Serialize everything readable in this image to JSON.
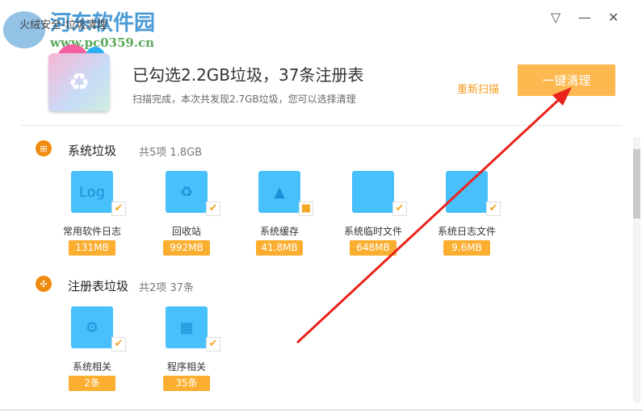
{
  "window": {
    "title": "火绒安全-垃圾清理",
    "watermark": "河东软件园",
    "watermark_url": "www.pc0359.cn"
  },
  "controls": {
    "menu": "▽",
    "minimize": "—",
    "close": "✕"
  },
  "header": {
    "headline": "已勾选2.2GB垃圾，37条注册表",
    "subtitle": "扫描完成，本次共发现2.7GB垃圾，您可以选择清理",
    "rescan": "重新扫描",
    "clean_button": "一键清理"
  },
  "sections": [
    {
      "name": "系统垃圾",
      "count": "共5项 1.8GB",
      "items": [
        {
          "label": "常用软件日志",
          "size": "131MB",
          "glyph": "Log",
          "checked": "✔"
        },
        {
          "label": "回收站",
          "size": "992MB",
          "glyph": "♻",
          "checked": "✔"
        },
        {
          "label": "系统缓存",
          "size": "41.8MB",
          "glyph": "▲",
          "checked": "■"
        },
        {
          "label": "系统临时文件",
          "size": "648MB",
          "glyph": "",
          "checked": "✔"
        },
        {
          "label": "系统日志文件",
          "size": "9.6MB",
          "glyph": "",
          "checked": "✔"
        }
      ]
    },
    {
      "name": "注册表垃圾",
      "count": "共2项 37条",
      "items": [
        {
          "label": "系统相关",
          "size": "2条",
          "glyph": "⚙",
          "checked": "✔"
        },
        {
          "label": "程序相关",
          "size": "35条",
          "glyph": "▦",
          "checked": "✔"
        }
      ]
    }
  ],
  "colors": {
    "accent": "#fdb84f",
    "section_icon": "#f08c10",
    "icon_blue": "#48c0fb",
    "arrow": "#e8241c"
  }
}
